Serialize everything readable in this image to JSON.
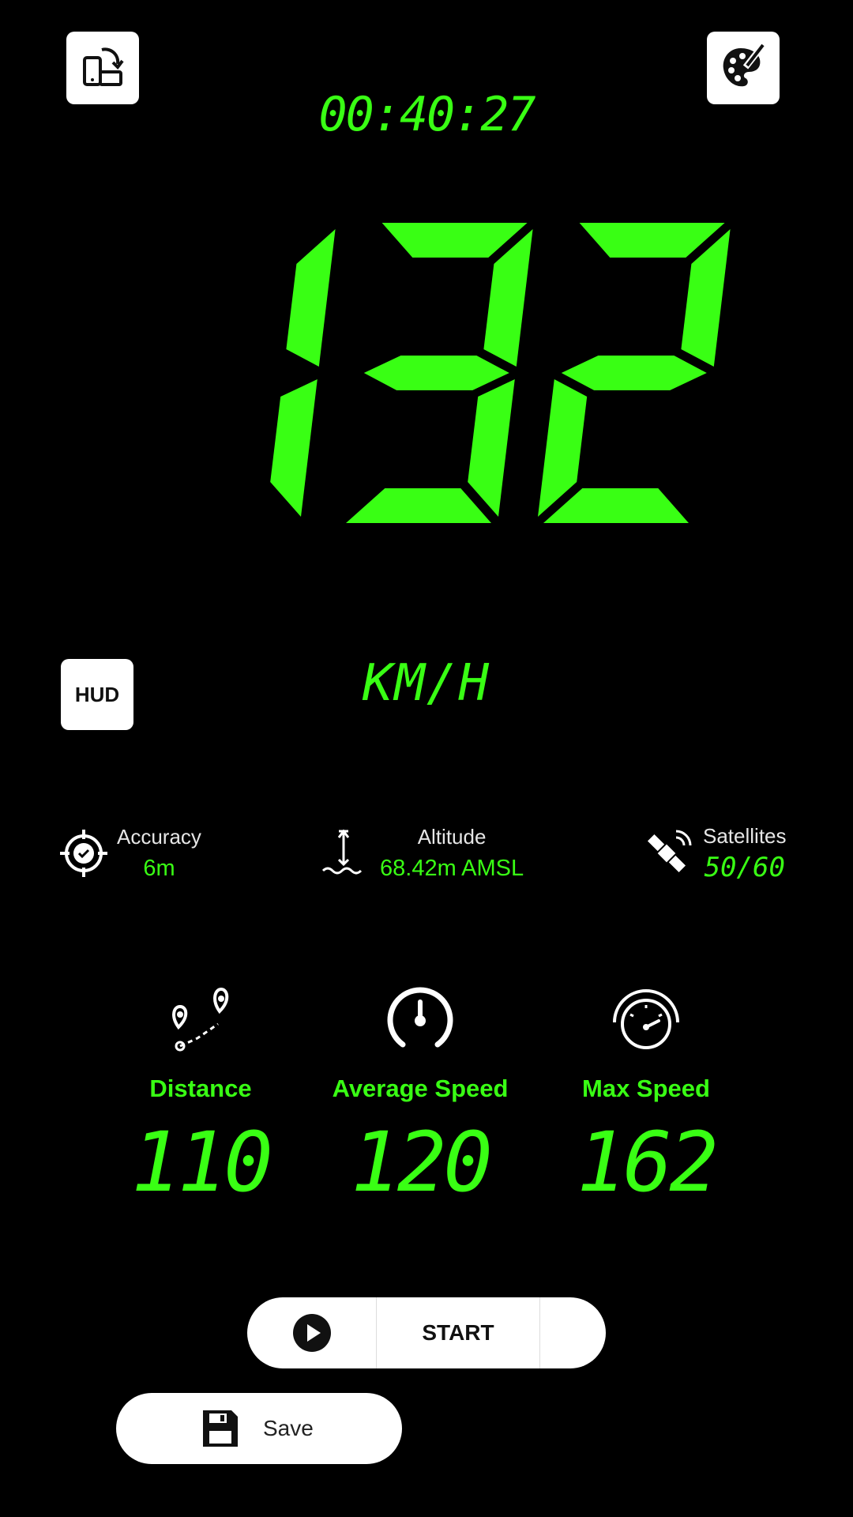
{
  "header": {
    "timer": "00:40:27"
  },
  "speed": {
    "value": "132",
    "unit": "KM/H"
  },
  "hud": {
    "label": "HUD"
  },
  "info": {
    "accuracy": {
      "label": "Accuracy",
      "value": "6m"
    },
    "altitude": {
      "label": "Altitude",
      "value": "68.42m AMSL"
    },
    "satellites": {
      "label": "Satellites",
      "value": "50/60"
    }
  },
  "stats": {
    "distance": {
      "label": "Distance",
      "value": "110"
    },
    "average_speed": {
      "label": "Average Speed",
      "value": "120"
    },
    "max_speed": {
      "label": "Max Speed",
      "value": "162"
    }
  },
  "controls": {
    "start_label": "START",
    "save_label": "Save"
  },
  "icons": {
    "rotate": "rotate-screen-icon",
    "theme": "palette-icon",
    "accuracy": "target-icon",
    "altitude": "altitude-icon",
    "satellites": "satellite-icon",
    "distance": "route-icon",
    "average_speed": "gauge-icon",
    "max_speed": "speedometer-icon",
    "play": "play-icon",
    "save": "floppy-disk-icon"
  },
  "colors": {
    "accent": "#39ff14",
    "background": "#000000"
  }
}
